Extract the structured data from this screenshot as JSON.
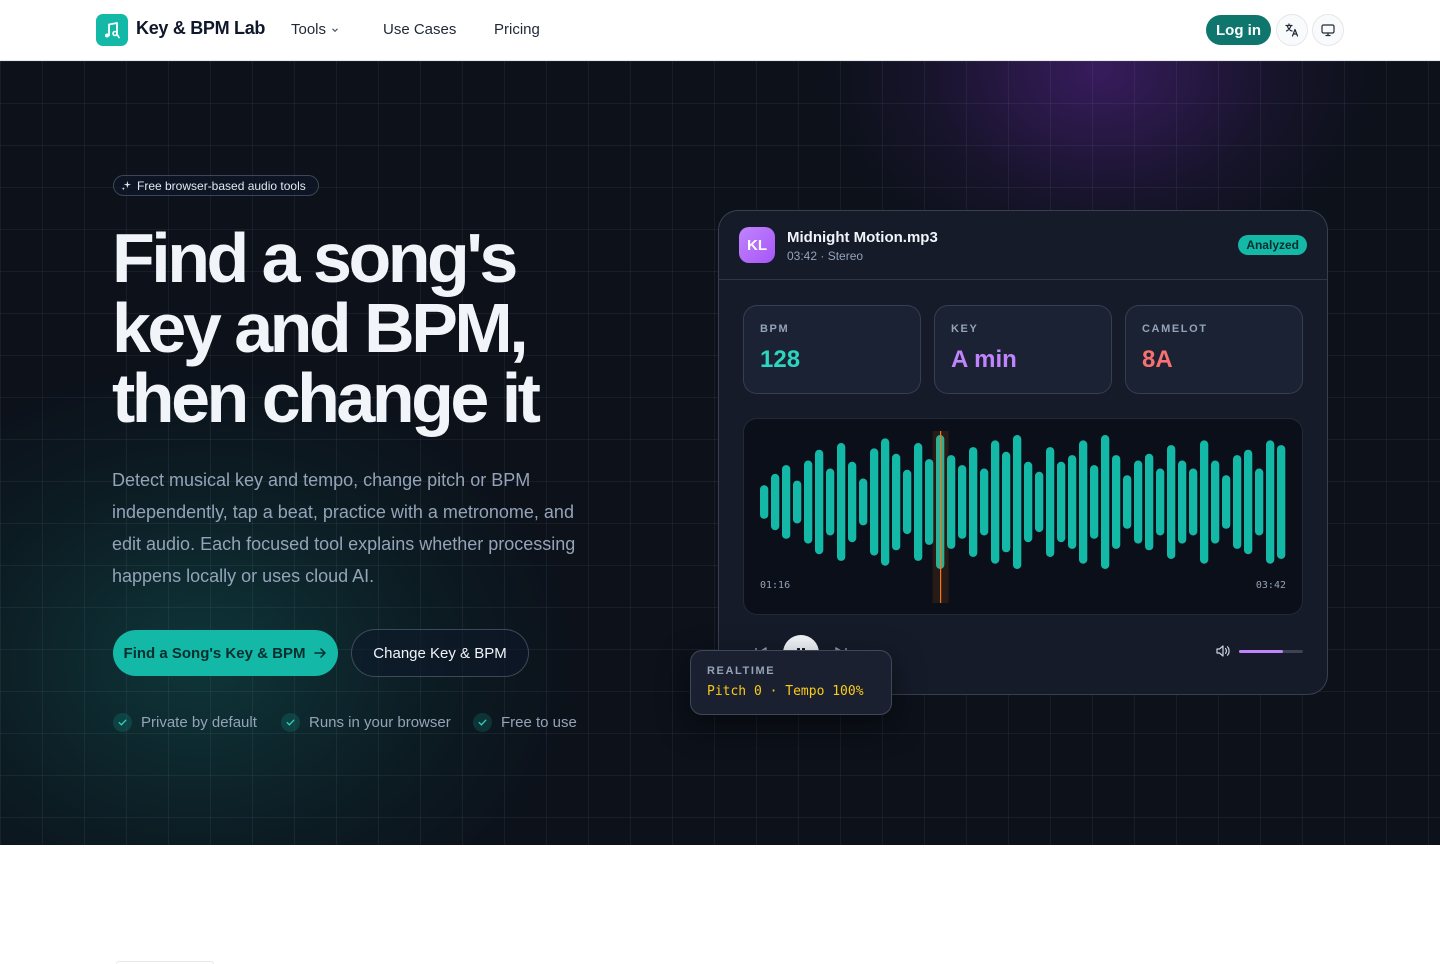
{
  "header": {
    "brand": "Key & BPM Lab",
    "logo_icon": "music-note-icon",
    "nav": [
      {
        "label": "Tools",
        "has_dropdown": true
      },
      {
        "label": "Use Cases"
      },
      {
        "label": "Pricing"
      }
    ],
    "login_label": "Log in",
    "language_icon": "translate-icon",
    "theme_icon": "monitor-icon"
  },
  "hero": {
    "badge": "Free browser-based audio tools",
    "headline_lines": [
      "Find a song's",
      "key and BPM,",
      "then change it"
    ],
    "subtext": "Detect musical key and tempo, change pitch or BPM independently, tap a beat, practice with a metronome, and edit audio. Each focused tool explains whether processing happens locally or uses cloud AI.",
    "cta_primary": "Find a Song's Key & BPM",
    "cta_secondary": "Change Key & BPM",
    "features": [
      "Private by default",
      "Runs in your browser",
      "Free to use"
    ]
  },
  "player": {
    "avatar": "KL",
    "file_name": "Midnight Motion.mp3",
    "file_meta": "03:42 · Stereo",
    "status": "Analyzed",
    "stats": [
      {
        "label": "BPM",
        "value": "128",
        "color": "#2dd4bf"
      },
      {
        "label": "KEY",
        "value": "A min",
        "color": "#c084fc"
      },
      {
        "label": "CAMELOT",
        "value": "8A",
        "color": "#f87171"
      }
    ],
    "time_current": "01:16",
    "time_total": "03:42",
    "progress": 0.342,
    "volume": 0.68,
    "waveform": [
      0.25,
      0.42,
      0.55,
      0.32,
      0.62,
      0.78,
      0.5,
      0.88,
      0.6,
      0.35,
      0.8,
      0.95,
      0.72,
      0.48,
      0.88,
      0.64,
      1.0,
      0.7,
      0.55,
      0.82,
      0.5,
      0.92,
      0.75,
      1.0,
      0.6,
      0.45,
      0.82,
      0.6,
      0.7,
      0.92,
      0.55,
      1.0,
      0.7,
      0.4,
      0.62,
      0.72,
      0.5,
      0.85,
      0.62,
      0.5,
      0.92,
      0.62,
      0.4,
      0.7,
      0.78,
      0.5,
      0.92,
      0.85
    ],
    "realtime_label": "REALTIME",
    "realtime_value": "Pitch 0 · Tempo 100%",
    "colors": {
      "wave": "#14b8a6",
      "playhead": "#f97316",
      "accent": "#c084fc"
    }
  }
}
